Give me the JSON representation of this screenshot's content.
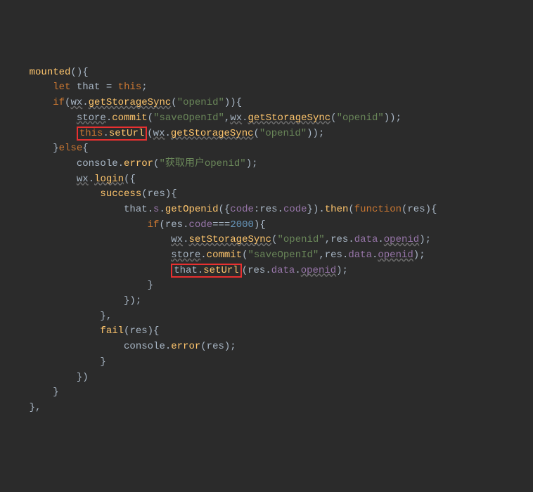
{
  "code": {
    "l1_mounted": "mounted",
    "l2_let": "let",
    "l2_that": "that",
    "l2_this": "this",
    "l3_if": "if",
    "l3_wx": "wx",
    "l3_getStorageSync": "getStorageSync",
    "l3_openid": "\"openid\"",
    "l4_store": "store",
    "l4_commit": "commit",
    "l4_saveOpenId": "\"saveOpenId\"",
    "l4_wx": "wx",
    "l4_getStorageSync": "getStorageSync",
    "l4_openid": "\"openid\"",
    "l5_this": "this",
    "l5_setUrl": "setUrl",
    "l5_wx": "wx",
    "l5_getStorageSync": "getStorageSync",
    "l5_openid": "\"openid\"",
    "l6_else": "else",
    "l7_console": "console",
    "l7_error": "error",
    "l7_msg": "\"获取用户openid\"",
    "l8_wx": "wx",
    "l8_login": "login",
    "l9_success": "success",
    "l9_res": "res",
    "l10_that": "that",
    "l10_s": "s",
    "l10_getOpenid": "getOpenid",
    "l10_code": "code",
    "l10_res": "res",
    "l10_codep": "code",
    "l10_then": "then",
    "l10_function": "function",
    "l10_res2": "res",
    "l11_if": "if",
    "l11_res": "res",
    "l11_code": "code",
    "l11_2000": "2000",
    "l12_wx": "wx",
    "l12_setStorageSync": "setStorageSync",
    "l12_openid": "\"openid\"",
    "l12_res": "res",
    "l12_data": "data",
    "l12_openidp": "openid",
    "l13_store": "store",
    "l13_commit": "commit",
    "l13_saveOpenId": "\"saveOpenId\"",
    "l13_res": "res",
    "l13_data": "data",
    "l13_openid": "openid",
    "l14_that": "that",
    "l14_setUrl": "setUrl",
    "l14_res": "res",
    "l14_data": "data",
    "l14_openid": "openid",
    "l17_fail": "fail",
    "l17_res": "res",
    "l18_console": "console",
    "l18_error": "error",
    "l18_res": "res"
  }
}
